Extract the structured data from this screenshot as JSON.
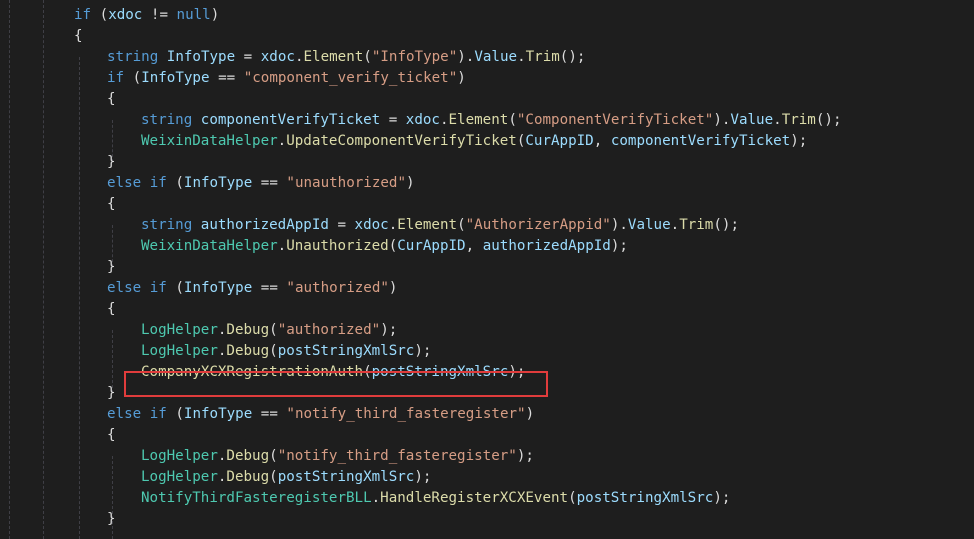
{
  "editor": {
    "colors": {
      "background": "#1e1e1e",
      "keyword": "#569cd6",
      "string": "#d69d85",
      "type": "#4ec9b0",
      "method": "#dcdcaa",
      "variable": "#9cdcfe",
      "plain": "#dcdcdc",
      "highlight_border": "#e03c3c"
    },
    "lines": [
      [
        {
          "t": "if",
          "c": "kw"
        },
        {
          "t": " (",
          "c": "pun"
        },
        {
          "t": "xdoc",
          "c": "var"
        },
        {
          "t": " != ",
          "c": "pun"
        },
        {
          "t": "null",
          "c": "kw"
        },
        {
          "t": ")",
          "c": "pun"
        }
      ],
      [
        {
          "t": "{",
          "c": "pun"
        }
      ],
      [
        {
          "t": "string",
          "c": "kw"
        },
        {
          "t": " ",
          "c": "pun"
        },
        {
          "t": "InfoType",
          "c": "var"
        },
        {
          "t": " = ",
          "c": "pun"
        },
        {
          "t": "xdoc",
          "c": "var"
        },
        {
          "t": ".",
          "c": "pun"
        },
        {
          "t": "Element",
          "c": "mth"
        },
        {
          "t": "(",
          "c": "pun"
        },
        {
          "t": "\"InfoType\"",
          "c": "str"
        },
        {
          "t": ").",
          "c": "pun"
        },
        {
          "t": "Value",
          "c": "var"
        },
        {
          "t": ".",
          "c": "pun"
        },
        {
          "t": "Trim",
          "c": "mth"
        },
        {
          "t": "();",
          "c": "pun"
        }
      ],
      [
        {
          "t": "if",
          "c": "kw"
        },
        {
          "t": " (",
          "c": "pun"
        },
        {
          "t": "InfoType",
          "c": "var"
        },
        {
          "t": " == ",
          "c": "pun"
        },
        {
          "t": "\"component_verify_ticket\"",
          "c": "str"
        },
        {
          "t": ")",
          "c": "pun"
        }
      ],
      [
        {
          "t": "{",
          "c": "pun"
        }
      ],
      [
        {
          "t": "string",
          "c": "kw"
        },
        {
          "t": " ",
          "c": "pun"
        },
        {
          "t": "componentVerifyTicket",
          "c": "var"
        },
        {
          "t": " = ",
          "c": "pun"
        },
        {
          "t": "xdoc",
          "c": "var"
        },
        {
          "t": ".",
          "c": "pun"
        },
        {
          "t": "Element",
          "c": "mth"
        },
        {
          "t": "(",
          "c": "pun"
        },
        {
          "t": "\"ComponentVerifyTicket\"",
          "c": "str"
        },
        {
          "t": ").",
          "c": "pun"
        },
        {
          "t": "Value",
          "c": "var"
        },
        {
          "t": ".",
          "c": "pun"
        },
        {
          "t": "Trim",
          "c": "mth"
        },
        {
          "t": "();",
          "c": "pun"
        }
      ],
      [
        {
          "t": "WeixinDataHelper",
          "c": "typ"
        },
        {
          "t": ".",
          "c": "pun"
        },
        {
          "t": "UpdateComponentVerifyTicket",
          "c": "mth"
        },
        {
          "t": "(",
          "c": "pun"
        },
        {
          "t": "CurAppID",
          "c": "var"
        },
        {
          "t": ", ",
          "c": "pun"
        },
        {
          "t": "componentVerifyTicket",
          "c": "var"
        },
        {
          "t": ");",
          "c": "pun"
        }
      ],
      [
        {
          "t": "}",
          "c": "pun"
        }
      ],
      [
        {
          "t": "else",
          "c": "kw"
        },
        {
          "t": " ",
          "c": "pun"
        },
        {
          "t": "if",
          "c": "kw"
        },
        {
          "t": " (",
          "c": "pun"
        },
        {
          "t": "InfoType",
          "c": "var"
        },
        {
          "t": " == ",
          "c": "pun"
        },
        {
          "t": "\"unauthorized\"",
          "c": "str"
        },
        {
          "t": ")",
          "c": "pun"
        }
      ],
      [
        {
          "t": "{",
          "c": "pun"
        }
      ],
      [
        {
          "t": "string",
          "c": "kw"
        },
        {
          "t": " ",
          "c": "pun"
        },
        {
          "t": "authorizedAppId",
          "c": "var"
        },
        {
          "t": " = ",
          "c": "pun"
        },
        {
          "t": "xdoc",
          "c": "var"
        },
        {
          "t": ".",
          "c": "pun"
        },
        {
          "t": "Element",
          "c": "mth"
        },
        {
          "t": "(",
          "c": "pun"
        },
        {
          "t": "\"AuthorizerAppid\"",
          "c": "str"
        },
        {
          "t": ").",
          "c": "pun"
        },
        {
          "t": "Value",
          "c": "var"
        },
        {
          "t": ".",
          "c": "pun"
        },
        {
          "t": "Trim",
          "c": "mth"
        },
        {
          "t": "();",
          "c": "pun"
        }
      ],
      [
        {
          "t": "WeixinDataHelper",
          "c": "typ"
        },
        {
          "t": ".",
          "c": "pun"
        },
        {
          "t": "Unauthorized",
          "c": "mth"
        },
        {
          "t": "(",
          "c": "pun"
        },
        {
          "t": "CurAppID",
          "c": "var"
        },
        {
          "t": ", ",
          "c": "pun"
        },
        {
          "t": "authorizedAppId",
          "c": "var"
        },
        {
          "t": ");",
          "c": "pun"
        }
      ],
      [
        {
          "t": "}",
          "c": "pun"
        }
      ],
      [
        {
          "t": "else",
          "c": "kw"
        },
        {
          "t": " ",
          "c": "pun"
        },
        {
          "t": "if",
          "c": "kw"
        },
        {
          "t": " (",
          "c": "pun"
        },
        {
          "t": "InfoType",
          "c": "var"
        },
        {
          "t": " == ",
          "c": "pun"
        },
        {
          "t": "\"authorized\"",
          "c": "str"
        },
        {
          "t": ")",
          "c": "pun"
        }
      ],
      [
        {
          "t": "{",
          "c": "pun"
        }
      ],
      [
        {
          "t": "LogHelper",
          "c": "typ"
        },
        {
          "t": ".",
          "c": "pun"
        },
        {
          "t": "Debug",
          "c": "mth"
        },
        {
          "t": "(",
          "c": "pun"
        },
        {
          "t": "\"authorized\"",
          "c": "str"
        },
        {
          "t": ");",
          "c": "pun"
        }
      ],
      [
        {
          "t": "LogHelper",
          "c": "typ"
        },
        {
          "t": ".",
          "c": "pun"
        },
        {
          "t": "Debug",
          "c": "mth"
        },
        {
          "t": "(",
          "c": "pun"
        },
        {
          "t": "postStringXmlSrc",
          "c": "var"
        },
        {
          "t": ");",
          "c": "pun"
        }
      ],
      [
        {
          "t": "CompanyXCXRegistrationAuth",
          "c": "mth"
        },
        {
          "t": "(",
          "c": "pun"
        },
        {
          "t": "postStringXmlSrc",
          "c": "var"
        },
        {
          "t": ");",
          "c": "pun"
        }
      ],
      [
        {
          "t": "}",
          "c": "pun"
        }
      ],
      [
        {
          "t": "else",
          "c": "kw"
        },
        {
          "t": " ",
          "c": "pun"
        },
        {
          "t": "if",
          "c": "kw"
        },
        {
          "t": " (",
          "c": "pun"
        },
        {
          "t": "InfoType",
          "c": "var"
        },
        {
          "t": " == ",
          "c": "pun"
        },
        {
          "t": "\"notify_third_fasteregister\"",
          "c": "str"
        },
        {
          "t": ")",
          "c": "pun"
        }
      ],
      [
        {
          "t": "{",
          "c": "pun"
        }
      ],
      [
        {
          "t": "LogHelper",
          "c": "typ"
        },
        {
          "t": ".",
          "c": "pun"
        },
        {
          "t": "Debug",
          "c": "mth"
        },
        {
          "t": "(",
          "c": "pun"
        },
        {
          "t": "\"notify_third_fasteregister\"",
          "c": "str"
        },
        {
          "t": ");",
          "c": "pun"
        }
      ],
      [
        {
          "t": "LogHelper",
          "c": "typ"
        },
        {
          "t": ".",
          "c": "pun"
        },
        {
          "t": "Debug",
          "c": "mth"
        },
        {
          "t": "(",
          "c": "pun"
        },
        {
          "t": "postStringXmlSrc",
          "c": "var"
        },
        {
          "t": ");",
          "c": "pun"
        }
      ],
      [
        {
          "t": "NotifyThirdFasteregisterBLL",
          "c": "typ"
        },
        {
          "t": ".",
          "c": "pun"
        },
        {
          "t": "HandleRegisterXCXEvent",
          "c": "mth"
        },
        {
          "t": "(",
          "c": "pun"
        },
        {
          "t": "postStringXmlSrc",
          "c": "var"
        },
        {
          "t": ");",
          "c": "pun"
        }
      ],
      [
        {
          "t": "}",
          "c": "pun"
        }
      ]
    ]
  }
}
